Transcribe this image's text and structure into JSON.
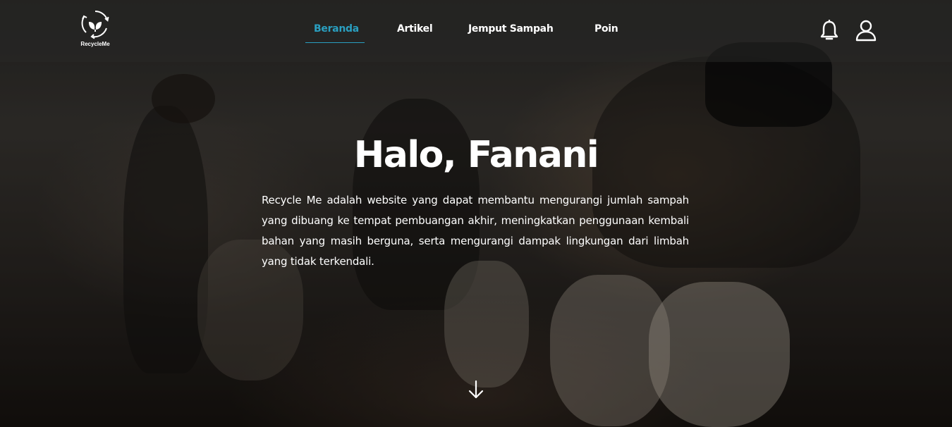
{
  "brand": {
    "name": "RecycleMe",
    "logo_icon": "recycle-leaf-icon"
  },
  "nav": {
    "items": [
      {
        "label": "Beranda",
        "active": true
      },
      {
        "label": "Artikel",
        "active": false
      },
      {
        "label": "Jemput Sampah",
        "active": false
      },
      {
        "label": "Poin",
        "active": false
      }
    ],
    "active_color": "#2a9fc0"
  },
  "actions": {
    "notification_icon": "bell-icon",
    "profile_icon": "user-icon"
  },
  "hero": {
    "greeting": "Halo, Fanani",
    "description": "Recycle Me adalah website yang dapat membantu mengurangi jumlah sampah yang dibuang ke tempat pembuangan akhir, meningkatkan penggunaan kembali bahan yang masih berguna, serta mengurangi dampak lingkungan dari limbah yang tidak terkendali.",
    "scroll_icon": "arrow-down-icon"
  }
}
